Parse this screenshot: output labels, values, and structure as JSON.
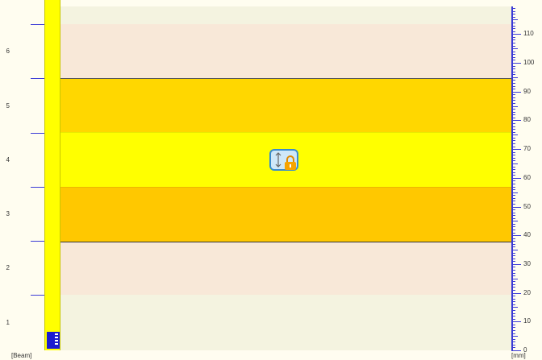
{
  "axes": {
    "left_unit": "[Beam]",
    "right_unit": "[mm]",
    "left_labels": [
      "1",
      "2",
      "3",
      "4",
      "5",
      "6"
    ],
    "right_labels": [
      "0",
      "10",
      "20",
      "30",
      "40",
      "50",
      "60",
      "70",
      "80",
      "90",
      "100",
      "110"
    ]
  },
  "bands": [
    {
      "name": "beam-band-1",
      "color": "#f4f3e0"
    },
    {
      "name": "beam-band-2",
      "color": "#f8e8d8"
    },
    {
      "name": "beam-band-3",
      "color": "#ffc800"
    },
    {
      "name": "beam-band-4",
      "color": "#ffff00"
    },
    {
      "name": "beam-band-5",
      "color": "#ffd700"
    },
    {
      "name": "beam-band-6",
      "color": "#f8e8d8"
    }
  ],
  "center_icon": "vertical-size-lock-icon",
  "colors": {
    "ruler_blue": "#3b3bd6",
    "beam_yellow": "#ffff00",
    "marker_blue": "#1c1cd0"
  }
}
